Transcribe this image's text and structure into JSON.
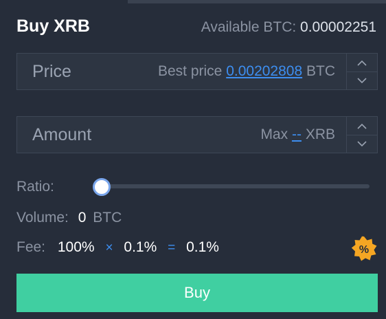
{
  "header": {
    "title": "Buy XRB",
    "available_label": "Available BTC:",
    "available_value": "0.00002251"
  },
  "price_field": {
    "label": "Price",
    "hint_prefix": "Best price",
    "best_price": "0.00202808",
    "unit": "BTC"
  },
  "amount_field": {
    "label": "Amount",
    "hint_prefix": "Max",
    "max_value": "--",
    "unit": "XRB"
  },
  "ratio": {
    "label": "Ratio:",
    "value_fraction": 0
  },
  "volume": {
    "label": "Volume:",
    "value": "0",
    "unit": "BTC"
  },
  "fee": {
    "label": "Fee:",
    "rate": "100%",
    "times": "×",
    "base": "0.1%",
    "equals": "=",
    "result": "0.1%",
    "badge": "%"
  },
  "buy_button": {
    "label": "Buy"
  },
  "colors": {
    "background": "#262d3a",
    "accent_blue": "#3d8ef0",
    "buy_green": "#40cfa1",
    "badge_orange": "#f5a623"
  }
}
